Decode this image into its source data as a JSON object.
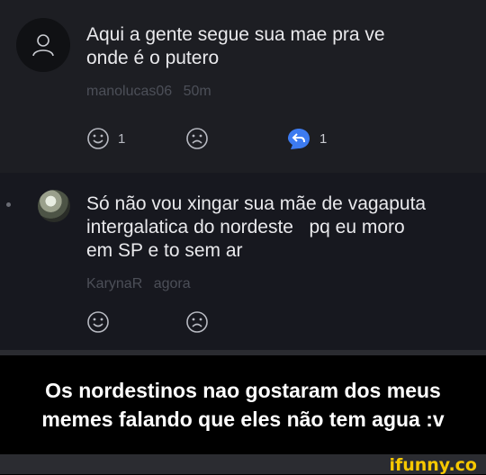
{
  "comments": [
    {
      "text": "Aqui a gente segue sua mae pra ve\nonde é o putero",
      "username": "manolucas06",
      "time": "50m",
      "smile_count": "1",
      "reply_count": "1",
      "avatar_icon": "user-placeholder-icon"
    },
    {
      "text": "Só não vou xingar sua mãe de vagaputa\nintergalatica do nordeste   pq eu moro\nem SP e to sem ar",
      "username": "KarynaR",
      "time": "agora",
      "avatar_icon": "user-photo-avatar"
    }
  ],
  "caption": "Os nordestinos nao gostaram dos meus memes falando que eles não tem agua :v",
  "watermark": "ifunny.co",
  "colors": {
    "reply_accent": "#3d7bf0",
    "watermark": "#f7c800"
  }
}
